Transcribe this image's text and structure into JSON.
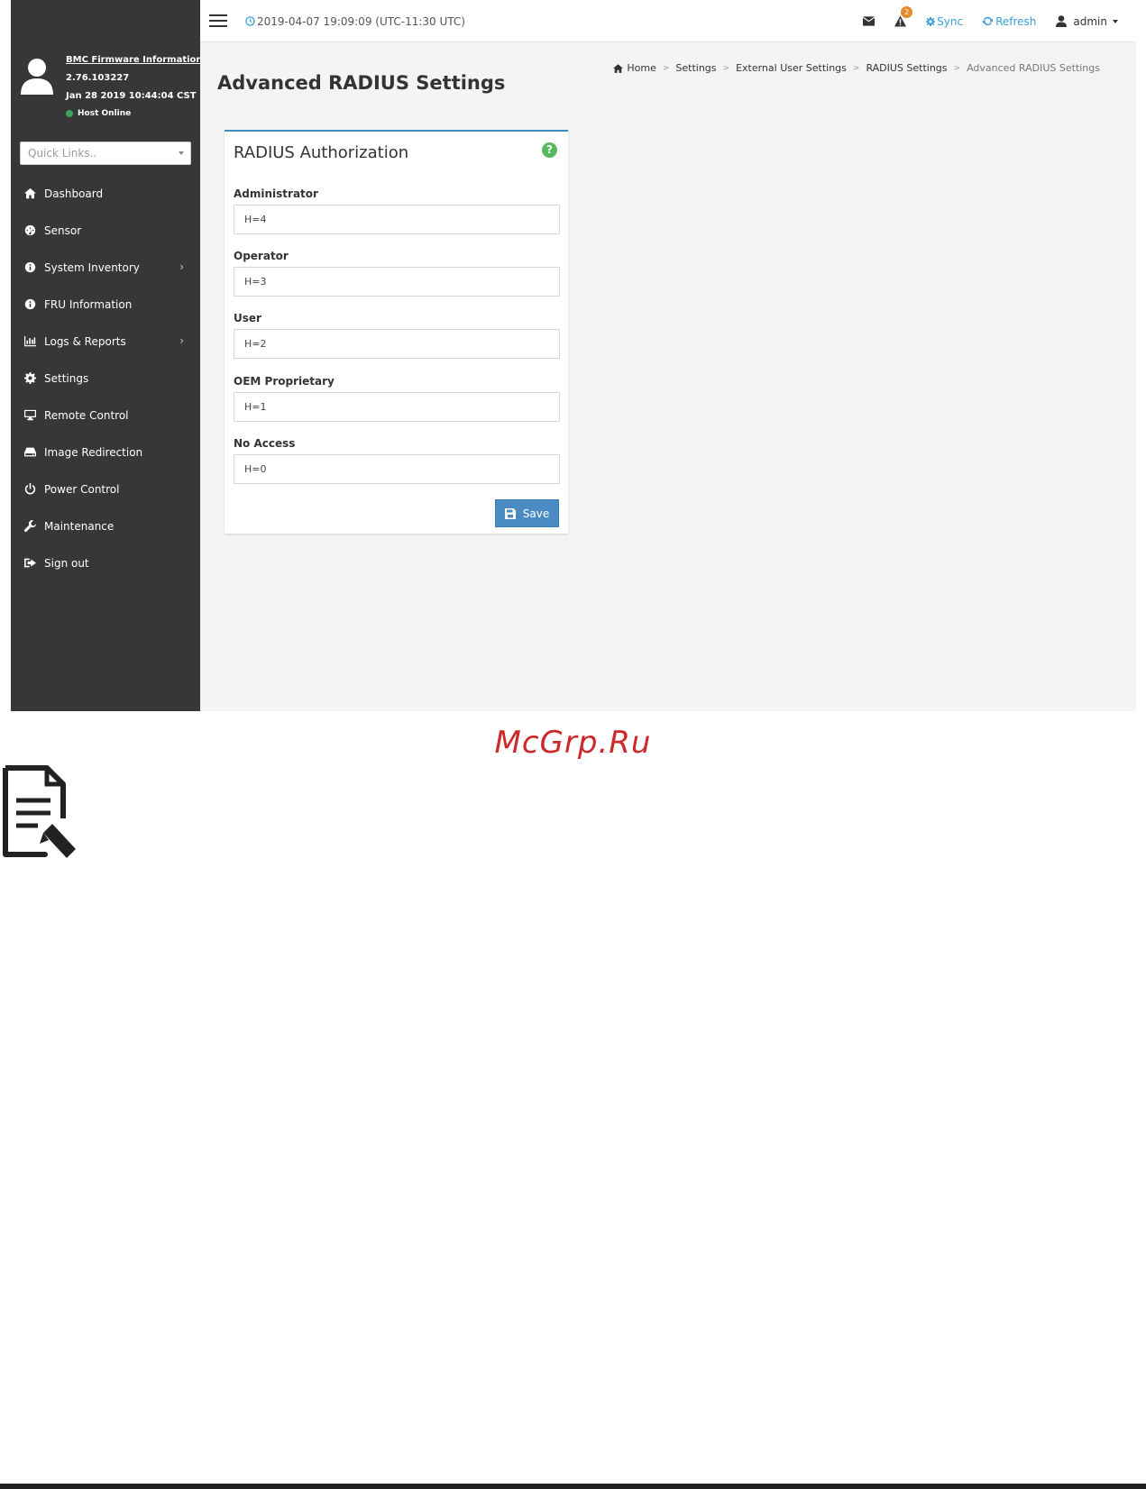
{
  "sidebar": {
    "firmware_link": "BMC Firmware Information",
    "firmware_version": "2.76.103227",
    "firmware_date": "Jan 28 2019 10:44:04 CST",
    "host_status": "Host Online",
    "quick_links_placeholder": "Quick Links..",
    "items": [
      {
        "label": "Dashboard",
        "icon": "home-icon",
        "has_submenu": false
      },
      {
        "label": "Sensor",
        "icon": "dashboard-gauge-icon",
        "has_submenu": false
      },
      {
        "label": "System Inventory",
        "icon": "info-icon",
        "has_submenu": true
      },
      {
        "label": "FRU Information",
        "icon": "info-icon",
        "has_submenu": false
      },
      {
        "label": "Logs & Reports",
        "icon": "bar-chart-icon",
        "has_submenu": true
      },
      {
        "label": "Settings",
        "icon": "gear-icon",
        "has_submenu": false
      },
      {
        "label": "Remote Control",
        "icon": "monitor-icon",
        "has_submenu": false
      },
      {
        "label": "Image Redirection",
        "icon": "hdd-icon",
        "has_submenu": false
      },
      {
        "label": "Power Control",
        "icon": "power-icon",
        "has_submenu": false
      },
      {
        "label": "Maintenance",
        "icon": "wrench-icon",
        "has_submenu": false
      },
      {
        "label": "Sign out",
        "icon": "sign-out-icon",
        "has_submenu": false
      }
    ]
  },
  "topbar": {
    "datetime": "2019-04-07 19:09:09 (UTC-11:30 UTC)",
    "alert_count": "2",
    "sync_label": "Sync",
    "refresh_label": "Refresh",
    "user_label": "admin"
  },
  "breadcrumb": [
    "Home",
    "Settings",
    "External User Settings",
    "RADIUS Settings",
    "Advanced RADIUS Settings"
  ],
  "page": {
    "title": "Advanced RADIUS Settings"
  },
  "card": {
    "title": "RADIUS Authorization",
    "help": "?",
    "fields": [
      {
        "label": "Administrator",
        "value": "H=4"
      },
      {
        "label": "Operator",
        "value": "H=3"
      },
      {
        "label": "User",
        "value": "H=2"
      },
      {
        "label": "OEM Proprietary",
        "value": "H=1"
      },
      {
        "label": "No Access",
        "value": "H=0"
      }
    ],
    "save_label": "Save"
  },
  "watermark": "McGrp.Ru",
  "colors": {
    "sidebar_bg": "#37373a",
    "content_bg": "#f4f4f4",
    "accent": "#3c8dbc",
    "button": "#4a8bc4",
    "online": "#3ba55c",
    "help": "#5cb85c",
    "badge": "#e08a2c",
    "watermark": "#cc2a2a"
  }
}
